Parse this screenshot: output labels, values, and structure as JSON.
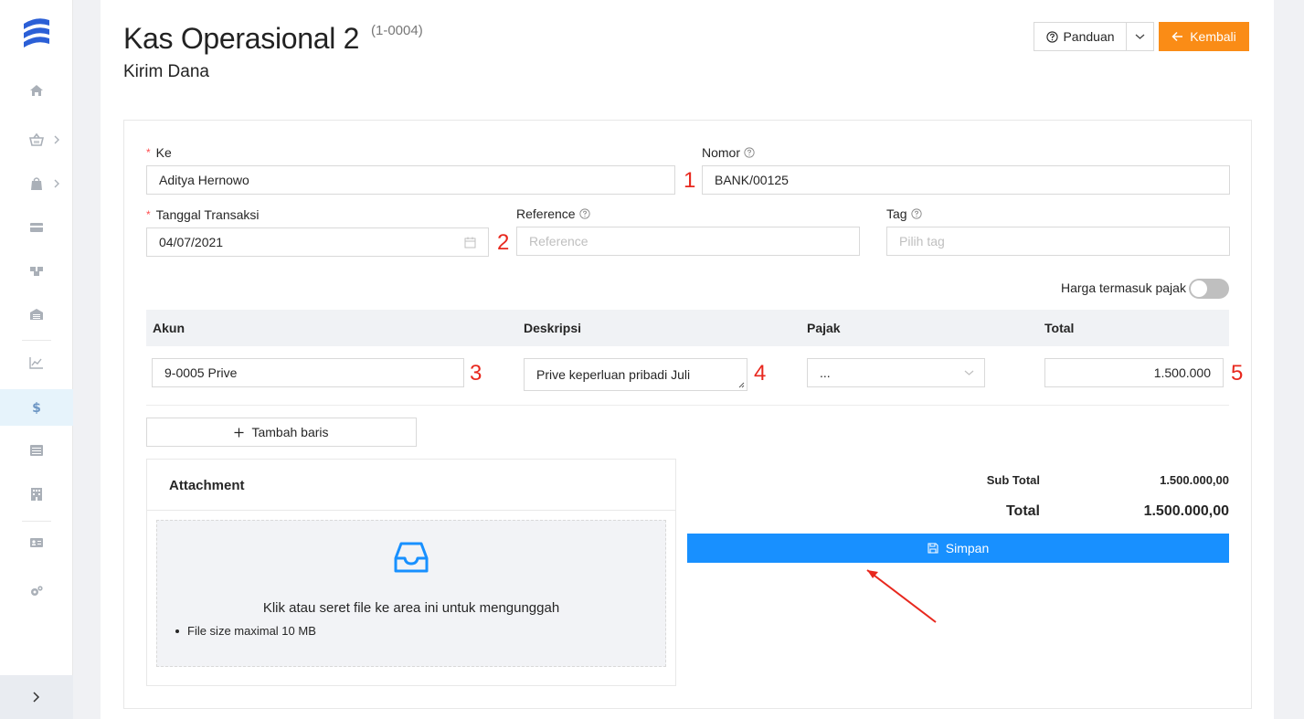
{
  "app": {
    "accent_color": "#1890ff",
    "warn_color": "#fa8c16"
  },
  "sidebar": {
    "items": [
      {
        "icon": "home-icon"
      },
      {
        "icon": "basket-icon",
        "has_submenu": true
      },
      {
        "icon": "shopping-bag-icon",
        "has_submenu": true
      },
      {
        "icon": "credit-card-icon"
      },
      {
        "icon": "boxes-icon"
      },
      {
        "icon": "warehouse-icon"
      },
      {
        "icon": "line-chart-icon"
      },
      {
        "icon": "dollar-icon",
        "active": true
      },
      {
        "icon": "list-icon"
      },
      {
        "icon": "building-icon"
      },
      {
        "icon": "contact-card-icon"
      },
      {
        "icon": "settings-icon"
      }
    ],
    "footer_label": ">"
  },
  "header": {
    "title": "Kas Operasional 2",
    "code": "(1-0004)",
    "subtitle": "Kirim Dana",
    "guide_label": "Panduan",
    "back_label": "Kembali"
  },
  "form": {
    "to_label": "Ke",
    "to_value": "Aditya Hernowo",
    "number_label": "Nomor",
    "number_value": "BANK/00125",
    "date_label": "Tanggal Transaksi",
    "date_value": "04/07/2021",
    "reference_label": "Reference",
    "reference_placeholder": "Reference",
    "tag_label": "Tag",
    "tag_placeholder": "Pilih tag",
    "tax_toggle_label": "Harga termasuk pajak",
    "tax_toggle_on": false
  },
  "table": {
    "headers": [
      "Akun",
      "Deskripsi",
      "Pajak",
      "Total"
    ],
    "rows": [
      {
        "account": "9-0005 Prive",
        "description": "Prive keperluan pribadi Juli",
        "tax": "...",
        "total": "1.500.000"
      }
    ],
    "add_row_label": "Tambah baris"
  },
  "attachment": {
    "title": "Attachment",
    "drop_text": "Klik atau seret file ke area ini untuk mengunggah",
    "note": "File size maximal 10 MB"
  },
  "summary": {
    "subtotal_label": "Sub Total",
    "subtotal_value": "1.500.000,00",
    "total_label": "Total",
    "total_value": "1.500.000,00"
  },
  "save_label": "Simpan",
  "annotations": [
    "1",
    "2",
    "3",
    "4",
    "5"
  ]
}
